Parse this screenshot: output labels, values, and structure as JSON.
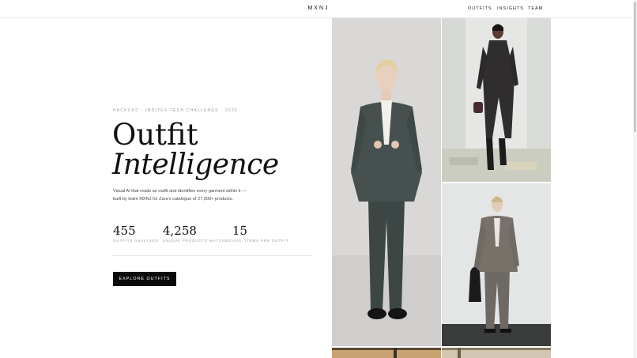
{
  "header": {
    "brand": "MXNJ",
    "nav": [
      {
        "label": "OUTFITS"
      },
      {
        "label": "INSIGHTS"
      },
      {
        "label": "TEAM"
      }
    ]
  },
  "hero": {
    "eyebrow": "HACKUDC · INDITEX TECH CHALLENGE · 2026",
    "title_line1": "Outfit",
    "title_line2": "Intelligence",
    "description": "Visual AI that reads an outfit and identifies every garment within it — built by team MXNJ for Zara's catalogue of 27,000+ products.",
    "stats": [
      {
        "value": "455",
        "label": "OUTFITS ANALYSED"
      },
      {
        "value": "4,258",
        "label": "UNIQUE PRODUCTS MATCHED"
      },
      {
        "value": "15",
        "label": "AVG. ITEMS PER OUTFIT"
      }
    ],
    "cta_label": "EXPLORE OUTFITS"
  },
  "gallery": {
    "photos": [
      {
        "subject": "child in dark green suit"
      },
      {
        "subject": "model in dark belted jumpsuit with handbag"
      },
      {
        "subject": "model in grey suit with black bag"
      },
      {
        "subject": "partial outfit photo"
      },
      {
        "subject": "partial outfit photo"
      }
    ]
  },
  "colors": {
    "accent": "#0a0a0a",
    "text_muted": "#9a9a9a",
    "background": "#ffffff"
  }
}
